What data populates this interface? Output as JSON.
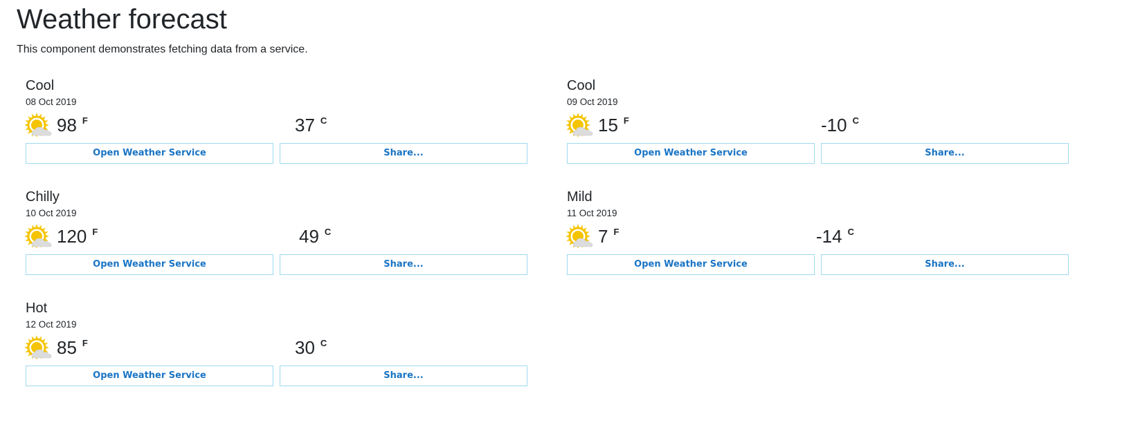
{
  "page": {
    "title": "Weather forecast",
    "subtitle": "This component demonstrates fetching data from a service."
  },
  "colors": {
    "text": "#212529",
    "button_text": "#1a74c4",
    "button_border": "#9fd9f0",
    "sun": "#f5c400",
    "cloud": "#dcdcdc"
  },
  "forecasts": [
    {
      "summary": "Cool",
      "date": "08 Oct 2019",
      "icon": "partly-cloudy-icon",
      "temp_f": "98",
      "unit_f": "F",
      "temp_c": "37",
      "unit_c": "C",
      "open_label": "Open Weather Service",
      "share_label": "Share..."
    },
    {
      "summary": "Cool",
      "date": "09 Oct 2019",
      "icon": "partly-cloudy-icon",
      "temp_f": "15",
      "unit_f": "F",
      "temp_c": "-10",
      "unit_c": "C",
      "open_label": "Open Weather Service",
      "share_label": "Share..."
    },
    {
      "summary": "Chilly",
      "date": "10 Oct 2019",
      "icon": "partly-cloudy-icon",
      "temp_f": "120",
      "unit_f": "F",
      "temp_c": "49",
      "unit_c": "C",
      "open_label": "Open Weather Service",
      "share_label": "Share..."
    },
    {
      "summary": "Mild",
      "date": "11 Oct 2019",
      "icon": "partly-cloudy-icon",
      "temp_f": "7",
      "unit_f": "F",
      "temp_c": "-14",
      "unit_c": "C",
      "open_label": "Open Weather Service",
      "share_label": "Share..."
    },
    {
      "summary": "Hot",
      "date": "12 Oct 2019",
      "icon": "partly-cloudy-icon",
      "temp_f": "85",
      "unit_f": "F",
      "temp_c": "30",
      "unit_c": "C",
      "open_label": "Open Weather Service",
      "share_label": "Share..."
    }
  ]
}
